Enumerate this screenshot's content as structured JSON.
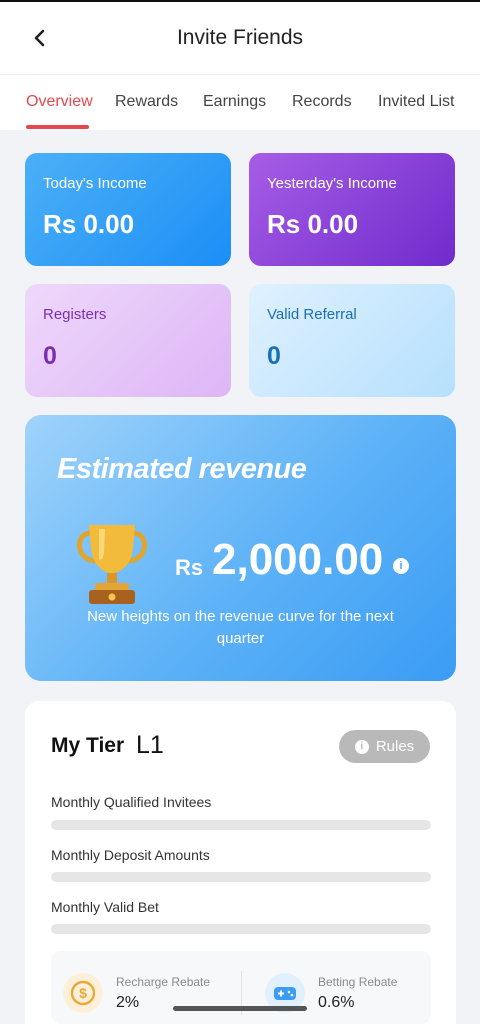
{
  "header": {
    "title": "Invite Friends"
  },
  "tabs": [
    {
      "label": "Overview"
    },
    {
      "label": "Rewards"
    },
    {
      "label": "Earnings"
    },
    {
      "label": "Records"
    },
    {
      "label": "Invited List"
    }
  ],
  "stats": {
    "today": {
      "label": "Today's Income",
      "value": "Rs 0.00"
    },
    "yesterday": {
      "label": "Yesterday's Income",
      "value": "Rs 0.00"
    },
    "registers": {
      "label": "Registers",
      "value": "0"
    },
    "valid_referral": {
      "label": "Valid Referral",
      "value": "0"
    }
  },
  "estimated": {
    "title": "Estimated revenue",
    "currency": "Rs",
    "amount": "2,000.00",
    "description": "New heights on the revenue curve for the next quarter"
  },
  "tier": {
    "label": "My Tier",
    "level": "L1",
    "rules_label": "Rules",
    "metrics": [
      {
        "label": "Monthly Qualified Invitees",
        "progress": 0
      },
      {
        "label": "Monthly Deposit Amounts",
        "progress": 0
      },
      {
        "label": "Monthly Valid Bet",
        "progress": 0
      }
    ]
  },
  "rebates": {
    "recharge": {
      "label": "Recharge Rebate",
      "value": "2%"
    },
    "betting": {
      "label": "Betting Rebate",
      "value": "0.6%"
    }
  },
  "icons": {
    "back": "chevron-left-icon",
    "trophy": "trophy-icon",
    "info": "info-icon",
    "coin": "coin-icon",
    "game": "gamepad-icon"
  },
  "colors": {
    "accent": "#e5484d",
    "today_card": "#1c8ef6",
    "yesterday_card": "#6f2bcc",
    "registers_card": "#e6c8f8",
    "referral_card": "#c9e8fe",
    "estimated_card": "#5db2f7",
    "rules_button": "#b9b9b9"
  }
}
